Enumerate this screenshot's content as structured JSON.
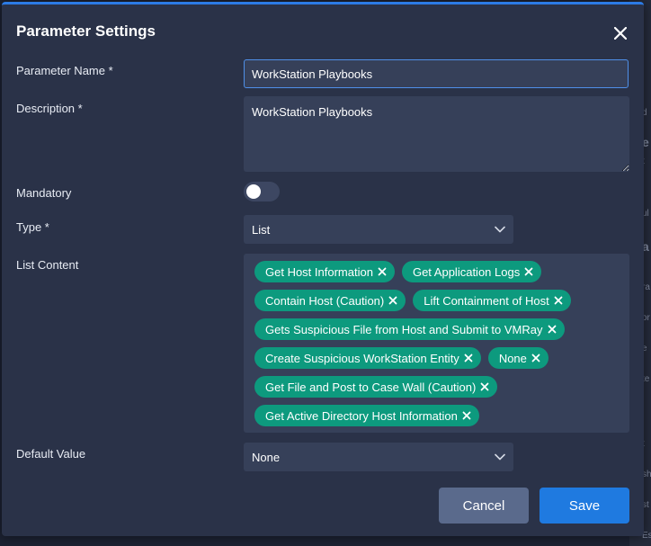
{
  "dialog": {
    "title": "Parameter Settings"
  },
  "form": {
    "parameter_name": {
      "label": "Parameter Name *",
      "value": "WorkStation Playbooks"
    },
    "description": {
      "label": "Description *",
      "value": "WorkStation Playbooks"
    },
    "mandatory": {
      "label": "Mandatory",
      "enabled": false
    },
    "type": {
      "label": "Type *",
      "value": "List"
    },
    "list_content": {
      "label": "List Content",
      "items": [
        "Get Host Information",
        "Get Application Logs",
        "Contain Host (Caution)",
        "Lift Containment of Host",
        "Gets Suspicious File from Host and Submit to VMRay",
        "Create Suspicious WorkStation Entity",
        "None",
        "Get File and Post to Case Wall (Caution)",
        "Get Active Directory Host Information"
      ]
    },
    "default_value": {
      "label": "Default Value",
      "value": "None"
    }
  },
  "footer": {
    "cancel_label": "Cancel",
    "save_label": "Save"
  },
  "background": {
    "fragments": [
      "d",
      "e",
      "t",
      "ul",
      "a",
      "ra",
      "or",
      "e",
      "te",
      "t",
      "sh",
      "st",
      "Esc"
    ]
  },
  "colors": {
    "accent": "#2c7be5",
    "chip": "#0d9a7e",
    "modal_bg": "#2a3248",
    "field_bg": "#364059",
    "save_button": "#1f7ae0",
    "cancel_button": "#5a6a8c"
  }
}
